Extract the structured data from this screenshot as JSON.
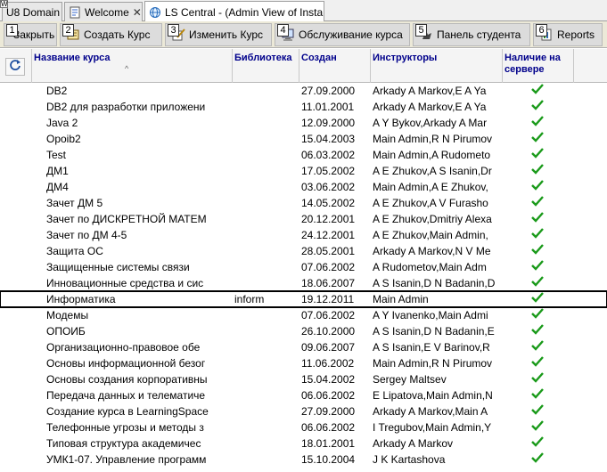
{
  "tabs": [
    {
      "label": "U8 Domain",
      "closable": false
    },
    {
      "label": "Welcome",
      "closable": true
    },
    {
      "label": "LS Central - (Admin View of Insta",
      "closable": true,
      "active": true
    }
  ],
  "corner_mark": "W",
  "toolbar": {
    "buttons": [
      {
        "num": "1",
        "label": "Закрыть"
      },
      {
        "num": "2",
        "label": "Создать Курс"
      },
      {
        "num": "3",
        "label": "Изменить Курс"
      },
      {
        "num": "4",
        "label": "Обслуживание курса"
      },
      {
        "num": "5",
        "label": "Панель студента"
      },
      {
        "num": "6",
        "label": "Reports"
      }
    ]
  },
  "grid": {
    "columns": {
      "name": "Название курса",
      "library": "Библиотека",
      "created": "Создан",
      "instructors": "Инструкторы",
      "on_server": "Наличие на сервере"
    },
    "sort_indicator": "^",
    "rows": [
      {
        "name": "DB2",
        "library": "",
        "created": "27.09.2000",
        "instructors": "Arkady A Markov,E A Ya",
        "on_server": true
      },
      {
        "name": "DB2 для разработки приложени",
        "library": "",
        "created": "11.01.2001",
        "instructors": "Arkady A Markov,E A Ya",
        "on_server": true
      },
      {
        "name": "Java 2",
        "library": "",
        "created": "12.09.2000",
        "instructors": "A Y Bykov,Arkady A Mar",
        "on_server": true
      },
      {
        "name": "Opoib2",
        "library": "",
        "created": "15.04.2003",
        "instructors": "Main Admin,R N Pirumov",
        "on_server": true
      },
      {
        "name": "Test",
        "library": "",
        "created": "06.03.2002",
        "instructors": "Main Admin,A Rudometo",
        "on_server": true
      },
      {
        "name": "ДМ1",
        "library": "",
        "created": "17.05.2002",
        "instructors": "A E Zhukov,A S Isanin,Dr",
        "on_server": true
      },
      {
        "name": "ДМ4",
        "library": "",
        "created": "03.06.2002",
        "instructors": "Main Admin,A E Zhukov,",
        "on_server": true
      },
      {
        "name": "Зачет ДМ 5",
        "library": "",
        "created": "14.05.2002",
        "instructors": "A E Zhukov,A V Furasho",
        "on_server": true
      },
      {
        "name": "Зачет по ДИСКРЕТНОЙ МАТЕМ",
        "library": "",
        "created": "20.12.2001",
        "instructors": "A E Zhukov,Dmitriy Alexa",
        "on_server": true
      },
      {
        "name": "Зачет по ДМ 4-5",
        "library": "",
        "created": "24.12.2001",
        "instructors": "A E Zhukov,Main Admin,",
        "on_server": true
      },
      {
        "name": "Защита ОС",
        "library": "",
        "created": "28.05.2001",
        "instructors": "Arkady A Markov,N V Me",
        "on_server": true
      },
      {
        "name": "Защищенные системы связи",
        "library": "",
        "created": "07.06.2002",
        "instructors": "A Rudometov,Main Adm",
        "on_server": true
      },
      {
        "name": "Инновационные средства и сис",
        "library": "",
        "created": "18.06.2007",
        "instructors": "A S Isanin,D N Badanin,D",
        "on_server": true
      },
      {
        "name": "Информатика",
        "library": "inform",
        "created": "19.12.2011",
        "instructors": "Main Admin",
        "on_server": true,
        "selected": true
      },
      {
        "name": "Модемы",
        "library": "",
        "created": "07.06.2002",
        "instructors": "A Y Ivanenko,Main Admi",
        "on_server": true
      },
      {
        "name": "ОПОИБ",
        "library": "",
        "created": "26.10.2000",
        "instructors": "A S Isanin,D N Badanin,E",
        "on_server": true
      },
      {
        "name": "Организационно-правовое обе",
        "library": "",
        "created": "09.06.2007",
        "instructors": "A S Isanin,E V Barinov,R",
        "on_server": true
      },
      {
        "name": "Основы информационной безог",
        "library": "",
        "created": "11.06.2002",
        "instructors": "Main Admin,R N Pirumov",
        "on_server": true
      },
      {
        "name": "Основы создания корпоративны",
        "library": "",
        "created": "15.04.2002",
        "instructors": "Sergey Maltsev",
        "on_server": true
      },
      {
        "name": "Передача данных и телематиче",
        "library": "",
        "created": "06.06.2002",
        "instructors": "E Lipatova,Main Admin,N",
        "on_server": true
      },
      {
        "name": "Создание курса в LearningSpace",
        "library": "",
        "created": "27.09.2000",
        "instructors": "Arkady A Markov,Main A",
        "on_server": true
      },
      {
        "name": "Телефонные угрозы и методы з",
        "library": "",
        "created": "06.06.2002",
        "instructors": "I Tregubov,Main Admin,Y",
        "on_server": true
      },
      {
        "name": "Типовая структура академичес",
        "library": "",
        "created": "18.01.2001",
        "instructors": "Arkady A Markov",
        "on_server": true
      },
      {
        "name": "УМК1-07. Управление программ",
        "library": "",
        "created": "15.10.2004",
        "instructors": "J K Kartashova",
        "on_server": true
      }
    ]
  },
  "colors": {
    "header_text": "#00008b",
    "check": "#1a9a1a",
    "toolbar_bg": "#ece9d8"
  }
}
